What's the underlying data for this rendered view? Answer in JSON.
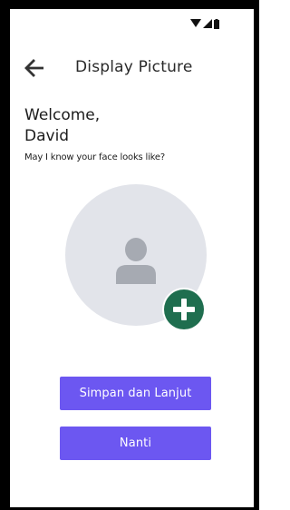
{
  "status_bar": {
    "icons": [
      "wifi-icon",
      "cellular-signal-icon",
      "battery-icon"
    ]
  },
  "app_bar": {
    "title": "Display Picture",
    "back_icon": "arrow-left-icon"
  },
  "greeting": {
    "line1": "Welcome,",
    "line2": "David"
  },
  "subtitle": "May I know your face looks like?",
  "avatar": {
    "placeholder_icon": "person-icon",
    "add_icon": "plus-icon"
  },
  "buttons": {
    "save_label": "Simpan dan Lanjut",
    "later_label": "Nanti"
  },
  "colors": {
    "primary": "#6c57f1",
    "add_button": "#1f6e4f",
    "avatar_bg": "#e2e4ea",
    "avatar_person": "#a6aab2",
    "text": "#1c1c1c"
  }
}
